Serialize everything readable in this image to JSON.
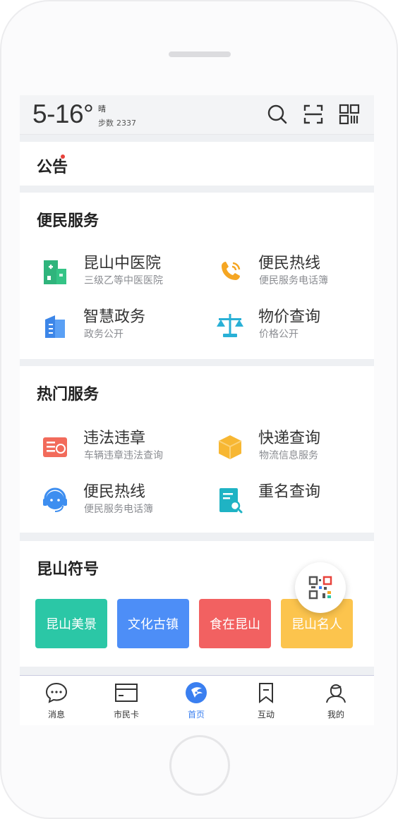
{
  "weather": {
    "temperature": "5-16°",
    "condition": "晴",
    "steps_label": "步数",
    "steps_value": "2337"
  },
  "topbar_icons": [
    "search-icon",
    "scan-icon",
    "qr-code-icon"
  ],
  "notice": {
    "title": "公告"
  },
  "convenience": {
    "title": "便民服务",
    "items": [
      {
        "name": "昆山中医院",
        "desc": "三级乙等中医医院",
        "icon": "hospital-icon"
      },
      {
        "name": "便民热线",
        "desc": "便民服务电话簿",
        "icon": "phone-icon"
      },
      {
        "name": "智慧政务",
        "desc": "政务公开",
        "icon": "government-building-icon"
      },
      {
        "name": "物价查询",
        "desc": "价格公开",
        "icon": "scale-icon"
      }
    ]
  },
  "hot": {
    "title": "热门服务",
    "items": [
      {
        "name": "违法违章",
        "desc": "车辆违章违法查询",
        "icon": "traffic-ticket-icon"
      },
      {
        "name": "快递查询",
        "desc": "物流信息服务",
        "icon": "package-icon"
      },
      {
        "name": "便民热线",
        "desc": "便民服务电话簿",
        "icon": "headset-icon"
      },
      {
        "name": "重名查询",
        "desc": "",
        "icon": "document-search-icon"
      }
    ]
  },
  "symbols": {
    "title": "昆山符号",
    "tiles": [
      {
        "label": "昆山美景",
        "color": "#2bc7a6"
      },
      {
        "label": "文化古镇",
        "color": "#4d8ef7"
      },
      {
        "label": "食在昆山",
        "color": "#f26161"
      },
      {
        "label": "昆山名人",
        "color": "#fcc44d"
      }
    ]
  },
  "tabs": [
    {
      "label": "消息",
      "icon": "message-icon"
    },
    {
      "label": "市民卡",
      "icon": "card-icon"
    },
    {
      "label": "首页",
      "icon": "home-logo-icon",
      "active": true
    },
    {
      "label": "互动",
      "icon": "bookmark-icon"
    },
    {
      "label": "我的",
      "icon": "user-icon"
    }
  ],
  "colors": {
    "accent": "#3a7ff0",
    "background": "#eef0f3"
  }
}
